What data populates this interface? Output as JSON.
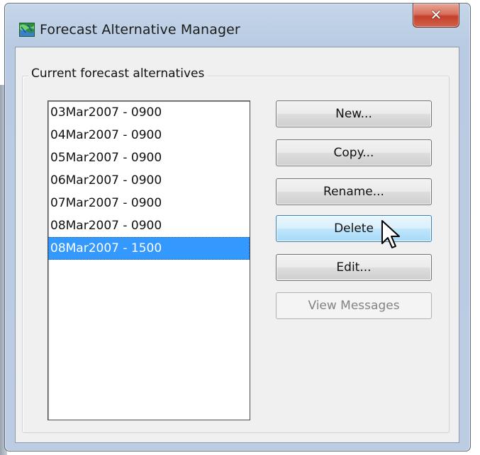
{
  "window": {
    "title": "Forecast Alternative Manager",
    "close_glyph": "✕",
    "app_icon": "forecast-map-icon"
  },
  "group": {
    "label": "Current forecast alternatives"
  },
  "alternatives": {
    "items": [
      "03Mar2007 - 0900",
      "04Mar2007 - 0900",
      "05Mar2007 - 0900",
      "06Mar2007 - 0900",
      "07Mar2007 - 0900",
      "08Mar2007 - 0900",
      "08Mar2007 - 1500"
    ],
    "selected": "08Mar2007 - 1500"
  },
  "buttons": {
    "new": "New...",
    "copy": "Copy...",
    "rename": "Rename...",
    "delete": "Delete",
    "edit": "Edit...",
    "view_messages": "View Messages"
  },
  "colors": {
    "selection": "#3399ff",
    "close_button": "#c4402b",
    "hover_button": "#bee6fd"
  }
}
